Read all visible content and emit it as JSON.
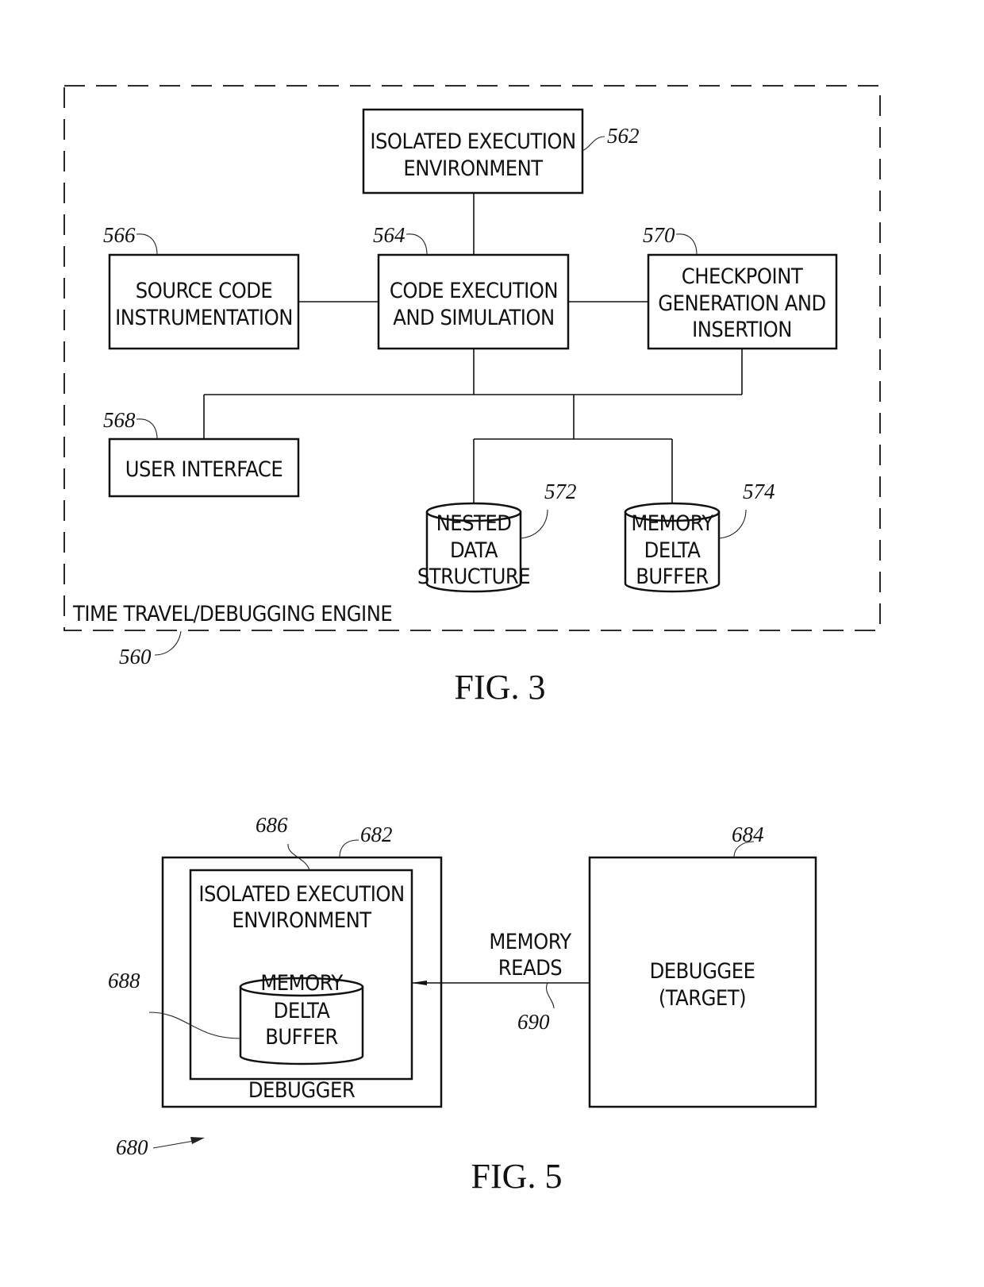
{
  "fig3": {
    "caption": "FIG. 3",
    "container": {
      "label": "TIME TRAVEL/DEBUGGING ENGINE",
      "ref": "560"
    },
    "nodes": {
      "isolated_env": {
        "lines": [
          "ISOLATED EXECUTION",
          "ENVIRONMENT"
        ],
        "ref": "562"
      },
      "code_exec": {
        "lines": [
          "CODE EXECUTION",
          "AND SIMULATION"
        ],
        "ref": "564"
      },
      "source_instr": {
        "lines": [
          "SOURCE CODE",
          "INSTRUMENTATION"
        ],
        "ref": "566"
      },
      "user_interface": {
        "lines": [
          "USER INTERFACE"
        ],
        "ref": "568"
      },
      "checkpoint": {
        "lines": [
          "CHECKPOINT",
          "GENERATION AND",
          "INSERTION"
        ],
        "ref": "570"
      },
      "nested_data": {
        "lines": [
          "NESTED",
          "DATA",
          "STRUCTURE"
        ],
        "ref": "572"
      },
      "mem_delta": {
        "lines": [
          "MEMORY",
          "DELTA",
          "BUFFER"
        ],
        "ref": "574"
      }
    }
  },
  "fig5": {
    "caption": "FIG. 5",
    "system_ref": "680",
    "debugger": {
      "label": "DEBUGGER",
      "ref": "682"
    },
    "isolated_env": {
      "lines": [
        "ISOLATED EXECUTION",
        "ENVIRONMENT"
      ],
      "ref": "686"
    },
    "mem_delta": {
      "lines": [
        "MEMORY",
        "DELTA",
        "BUFFER"
      ],
      "ref": "688"
    },
    "debuggee": {
      "lines": [
        "DEBUGGEE",
        "(TARGET)"
      ],
      "ref": "684"
    },
    "arrow": {
      "lines": [
        "MEMORY",
        "READS"
      ],
      "ref": "690"
    }
  }
}
